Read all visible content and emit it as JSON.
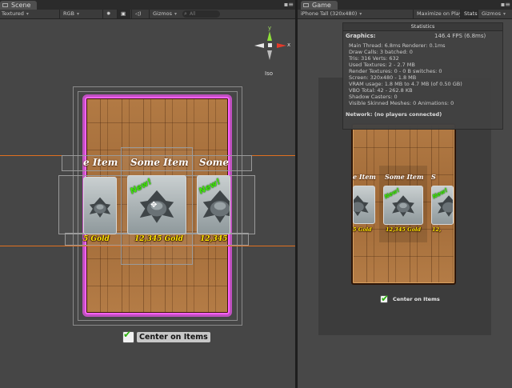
{
  "scene_panel": {
    "tab_label": "Scene",
    "toolbar": {
      "render_mode": "Textured",
      "color_mode": "RGB",
      "gizmos_label": "Gizmos",
      "search_placeholder": "All"
    },
    "gizmo": {
      "x_label": "x",
      "y_label": "y",
      "projection_label": "Iso"
    }
  },
  "game_panel": {
    "tab_label": "Game",
    "toolbar": {
      "resolution": "iPhone Tall (320x480)",
      "maximize_label": "Maximize on Play",
      "stats_label": "Stats",
      "gizmos_label": "Gizmos"
    }
  },
  "card": {
    "title": "Some Item",
    "price": "12,345 Gold",
    "left_title": "e Item",
    "right_title": "Some",
    "left_price": "5 Gold",
    "right_price": "12,345",
    "new_badge": "New!",
    "game_left_title": "e Item",
    "game_right_title": "S",
    "game_left_price": "5 Gold",
    "game_right_price": "12,"
  },
  "checkbox": {
    "label": "Center on Items",
    "checked": true
  },
  "statistics": {
    "title": "Statistics",
    "graphics_label": "Graphics:",
    "fps": "146.4 FPS (6.8ms)",
    "lines": [
      "Main Thread: 6.8ms  Renderer: 0.1ms",
      "Draw Calls: 3  batched: 0",
      "Tris: 316   Verts: 632",
      "Used Textures: 2 - 2.7 MB",
      "Render Textures: 0 - 0 B  switches: 0",
      "Screen: 320x480 - 1.8 MB",
      "VRAM usage: 1.8 MB to 4.7 MB (of 0.50 GB)",
      "VBO Total: 42 - 262.8 KB",
      "Shadow Casters: 0",
      "Visible Skinned Meshes: 0        Animations: 0"
    ],
    "network_label": "Network: (no players connected)"
  },
  "colors": {
    "selection_outline": "#ff60ff",
    "guide_line": "#e07020",
    "price_text": "#ffe600",
    "new_badge": "#43e80c"
  }
}
